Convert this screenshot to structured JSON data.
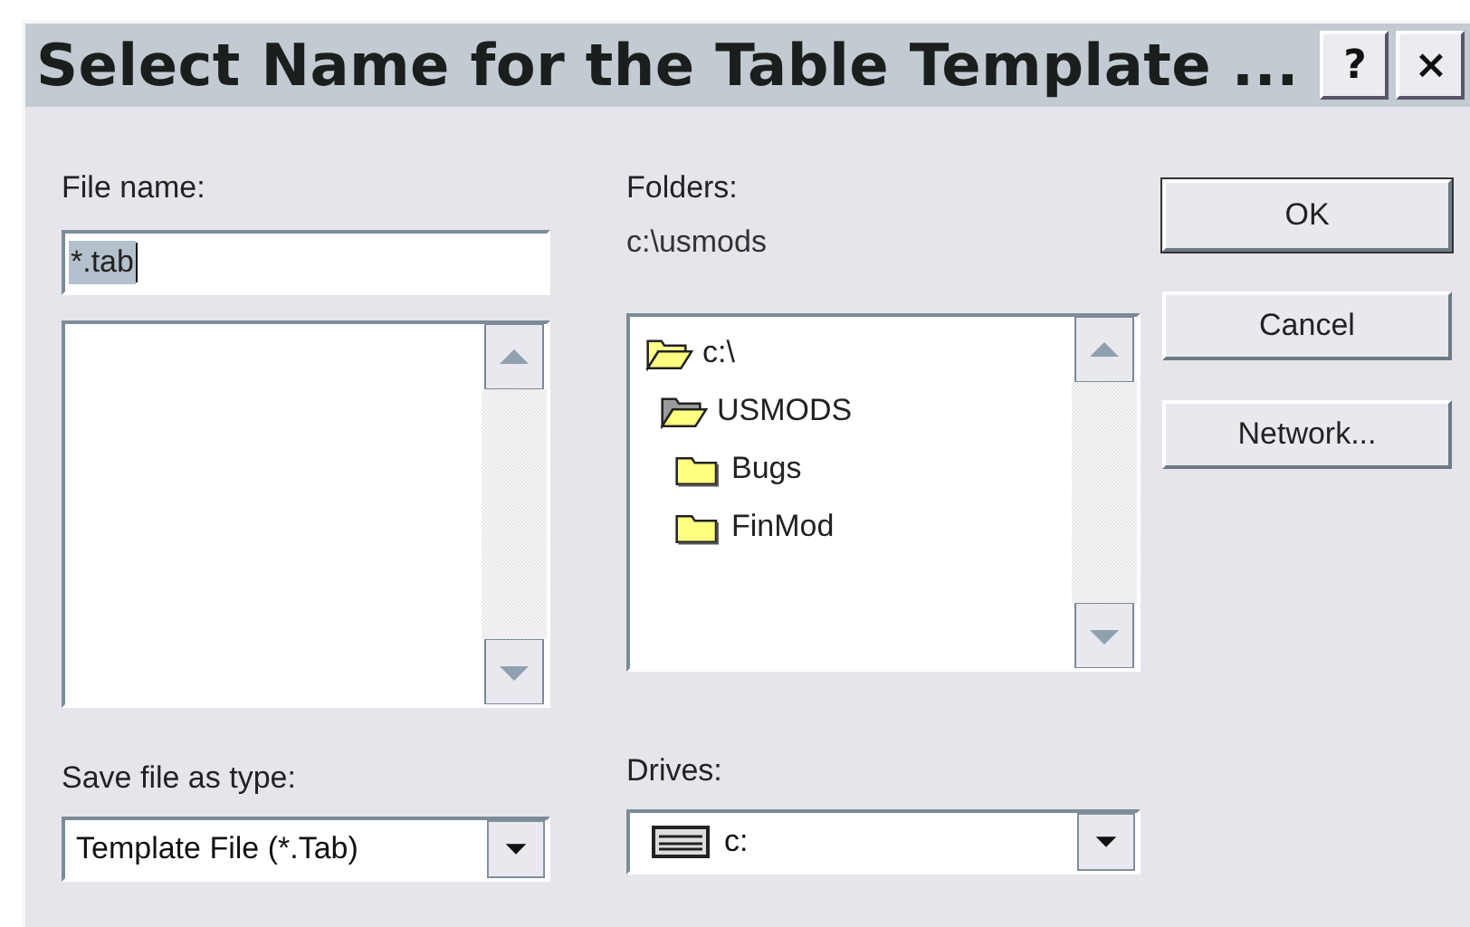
{
  "window": {
    "title": "Select Name for the Table Template ...",
    "title_buttons": [
      "?",
      "×"
    ]
  },
  "file_name": {
    "label": "File name:",
    "value": "*.tab",
    "text_selected": true
  },
  "folders": {
    "label": "Folders:",
    "path": "c:\\usmods",
    "tree": [
      {
        "name": "c:\\",
        "open": true,
        "children": [
          {
            "name": "USMODS",
            "open": true,
            "children": [
              {
                "name": "Bugs",
                "open": false
              },
              {
                "name": "FinMod",
                "open": false
              }
            ]
          }
        ]
      }
    ]
  },
  "buttons": [
    "OK",
    "Cancel",
    "Network..."
  ],
  "save_type": {
    "label": "Save file as type:",
    "value": "Template File (*.Tab)"
  },
  "drives": {
    "label": "Drives:",
    "value": "c:"
  }
}
